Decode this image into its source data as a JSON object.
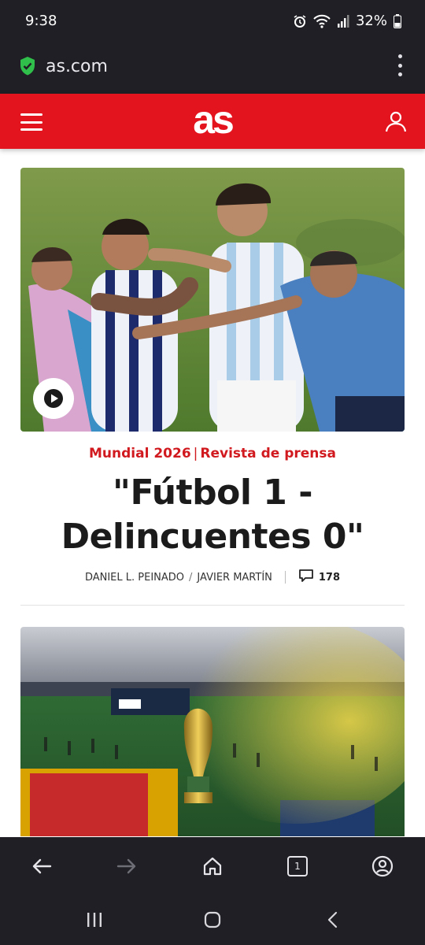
{
  "status_bar": {
    "time": "9:38",
    "battery": "32%",
    "icons": [
      "alarm-icon",
      "wifi-icon",
      "signal-icon",
      "battery-icon"
    ]
  },
  "browser": {
    "url": "as.com",
    "security_icon": "shield-check-icon",
    "menu_icon": "more-vert-icon",
    "tab_count": "1"
  },
  "site": {
    "logo": "as",
    "brand_color": "#e4141f",
    "menu_icon": "hamburger-icon",
    "account_icon": "user-icon"
  },
  "article1": {
    "media": "video",
    "play_icon": "play-icon",
    "section": "Mundial 2026",
    "separator": "|",
    "category": "Revista de prensa",
    "headline": "\"Fútbol 1 - Delincuentes 0\"",
    "authors": [
      "DANIEL L. PEINADO",
      "JAVIER MARTÍN"
    ],
    "author_sep": "/",
    "comment_icon": "comment-icon",
    "comments": "178"
  },
  "article2": {
    "media": "image"
  },
  "browser_nav": {
    "items": [
      "back-icon",
      "forward-icon",
      "home-icon",
      "tabs-icon",
      "profile-icon"
    ]
  },
  "system_nav": {
    "items": [
      "recents-icon",
      "home-icon",
      "back-icon"
    ]
  },
  "colors": {
    "chrome": "#1f1f25",
    "kicker": "#d11a1f",
    "headline": "#1b1b1b"
  }
}
